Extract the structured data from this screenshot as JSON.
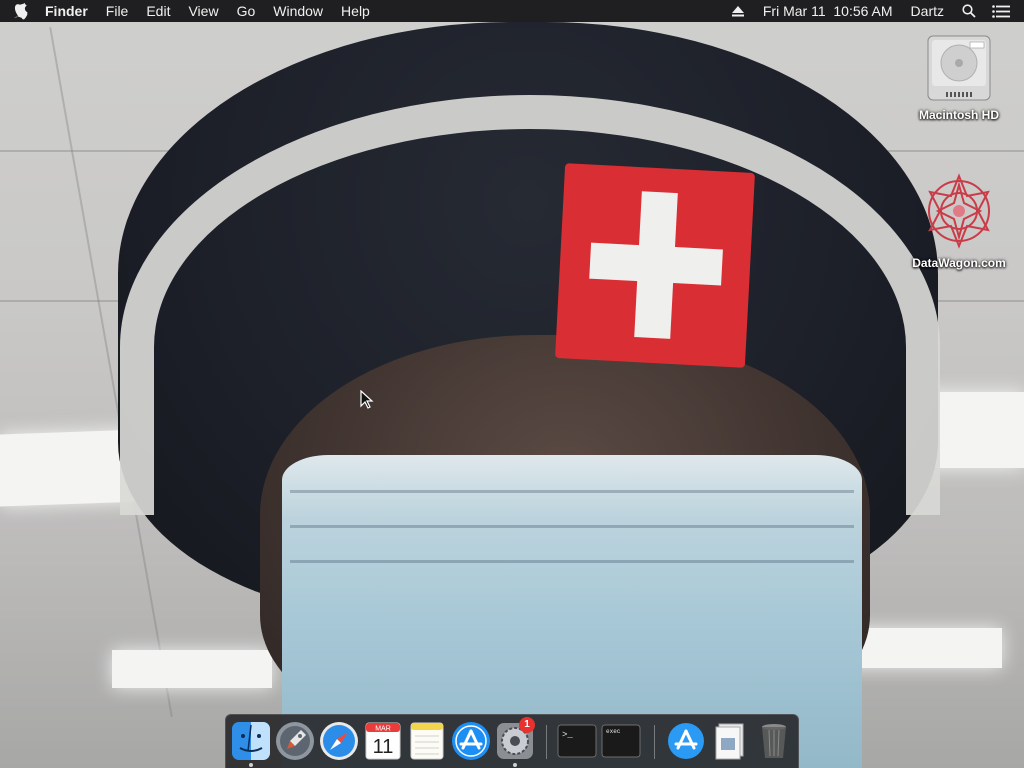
{
  "menubar": {
    "apple_icon": "apple-icon",
    "app_name": "Finder",
    "menus": [
      "File",
      "Edit",
      "View",
      "Go",
      "Window",
      "Help"
    ],
    "clock": "Fri Mar 11  10:56 AM",
    "user": "Dartz",
    "status_icons": [
      "eject-icon",
      "search-icon",
      "notification-center-icon"
    ]
  },
  "desktop": {
    "icons": [
      {
        "label": "Macintosh HD",
        "icon": "hard-drive-icon"
      },
      {
        "label": "DataWagon.com",
        "icon": "datawagon-icon"
      }
    ]
  },
  "dock": {
    "apps": [
      {
        "name": "Finder",
        "icon": "finder-icon",
        "running": true
      },
      {
        "name": "Launchpad",
        "icon": "launchpad-icon",
        "running": false
      },
      {
        "name": "Safari",
        "icon": "safari-icon",
        "running": false
      },
      {
        "name": "Calendar",
        "icon": "calendar-icon",
        "running": false,
        "month": "MAR",
        "day": "11"
      },
      {
        "name": "Notes",
        "icon": "notes-icon",
        "running": false
      },
      {
        "name": "App Store",
        "icon": "app-store-icon",
        "running": false
      },
      {
        "name": "System Preferences",
        "icon": "system-preferences-icon",
        "running": true,
        "badge": "1"
      },
      {
        "name": "Terminal",
        "icon": "terminal-icon",
        "running": false,
        "text": ">_"
      },
      {
        "name": "exec",
        "icon": "exec-icon",
        "running": false,
        "text": "exec"
      },
      {
        "name": "App Store Downloads",
        "icon": "app-store-folder-icon",
        "running": false
      },
      {
        "name": "Documents",
        "icon": "documents-stack-icon",
        "running": false
      },
      {
        "name": "Trash",
        "icon": "trash-icon",
        "running": false
      }
    ]
  },
  "colors": {
    "menubar_bg": "#1f1f21",
    "dock_bg": "#232326",
    "badge": "#e8322f",
    "flag_red": "#d92f34"
  }
}
